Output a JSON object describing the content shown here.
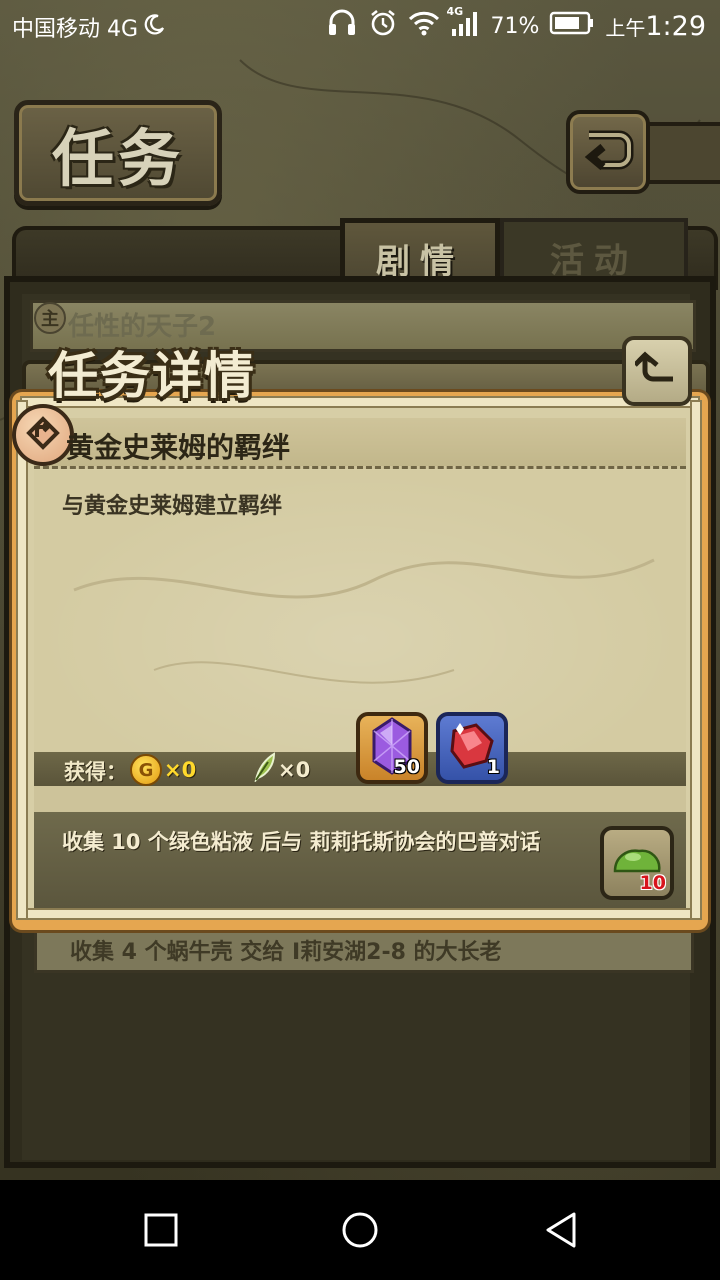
{
  "status_bar": {
    "carrier": "中国移动 4G",
    "network_small": "4G",
    "battery": "71%",
    "ampm": "上午",
    "time": "1:29",
    "icons": [
      "moon-icon",
      "headset-icon",
      "alarm-icon",
      "wifi-icon",
      "signal-icon",
      "battery-icon"
    ]
  },
  "header": {
    "title": "任务",
    "back_icon": "return-icon"
  },
  "tabs": [
    {
      "label": "剧情",
      "active": true
    },
    {
      "label": "活动",
      "active": false
    }
  ],
  "quest_list": [
    {
      "badge": "主",
      "title": "任性的天子2"
    },
    {
      "title": "收集 4 个蜗牛壳 交给 I莉安湖2-8 的大长老"
    }
  ],
  "dialog": {
    "title": "任务详情",
    "quest_name": "黄金史莱姆的羁绊",
    "description": "与黄金史莱姆建立羁绊",
    "rewards": {
      "label": "获得：",
      "coin_icon_text": "G",
      "coin_value": "×0",
      "feather_value": "×0",
      "items": [
        {
          "icon": "purple-crystal-icon",
          "count": "50"
        },
        {
          "icon": "red-ruby-icon",
          "count": "1"
        }
      ]
    },
    "next_step": "收集 10 个绿色粘液 后与 莉莉托斯协会的巴普对话",
    "next_item": {
      "icon": "green-slime-icon",
      "count": "10"
    }
  },
  "colors": {
    "dialog_border": "#e5a650",
    "parchment": "#d7cea6",
    "coin_text": "#ffd92c",
    "slime_count": "#d8141c"
  }
}
